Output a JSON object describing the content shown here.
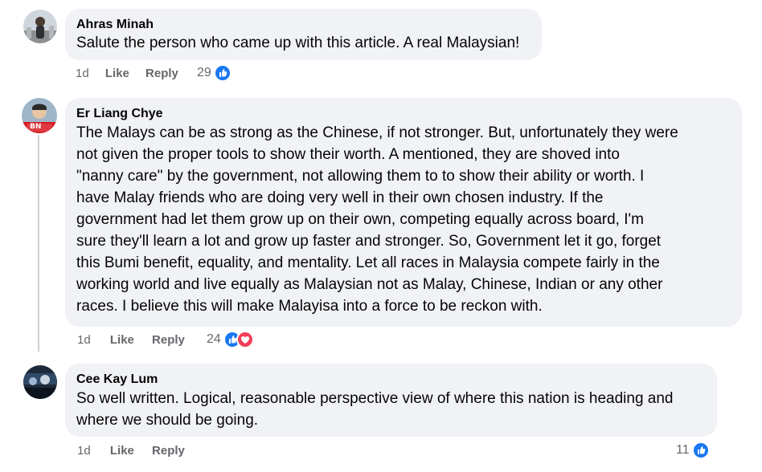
{
  "comments": [
    {
      "author": "Ahras Minah",
      "text": "Salute the person who came up with this article. A real Malaysian!",
      "time": "1d",
      "like_label": "Like",
      "reply_label": "Reply",
      "reaction_count": "29",
      "reactions": [
        "like-icon"
      ]
    },
    {
      "author": "Er Liang Chye",
      "text_lines": [
        "The Malays can be as strong as the Chinese, if not stronger. But, unfortunately they were",
        "not given the proper tools to show their worth. A mentioned, they are shoved into",
        "\"nanny care\" by the government, not allowing them to to show their ability or worth. I",
        "have Malay friends who are doing very well in their own chosen industry. If the",
        "government had let them grow up on their own, competing equally across board, I'm",
        "sure they'll learn a lot and grow up faster and stronger. So, Government let it go, forget",
        "this Bumi benefit, equality, and mentality. Let all races in Malaysia compete fairly in the",
        "working world and live equally as Malaysian not as Malay, Chinese, Indian or any other",
        "races. I believe this will make Malayisa into a force to be reckon with."
      ],
      "time": "1d",
      "like_label": "Like",
      "reply_label": "Reply",
      "reaction_count": "24",
      "reactions": [
        "like-icon",
        "love-icon"
      ],
      "avatar_badge": "BN"
    },
    {
      "author": "Cee Kay Lum",
      "text_lines": [
        "So well written. Logical, reasonable perspective view of where this nation is heading and",
        "where we should be going."
      ],
      "time": "1d",
      "like_label": "Like",
      "reply_label": "Reply",
      "reaction_count": "11",
      "reactions": [
        "like-icon"
      ]
    }
  ],
  "colors": {
    "bubble": "#f0f2f5",
    "meta": "#65676b",
    "like_blue": "#1877f2",
    "love_red": "#f33e58"
  }
}
